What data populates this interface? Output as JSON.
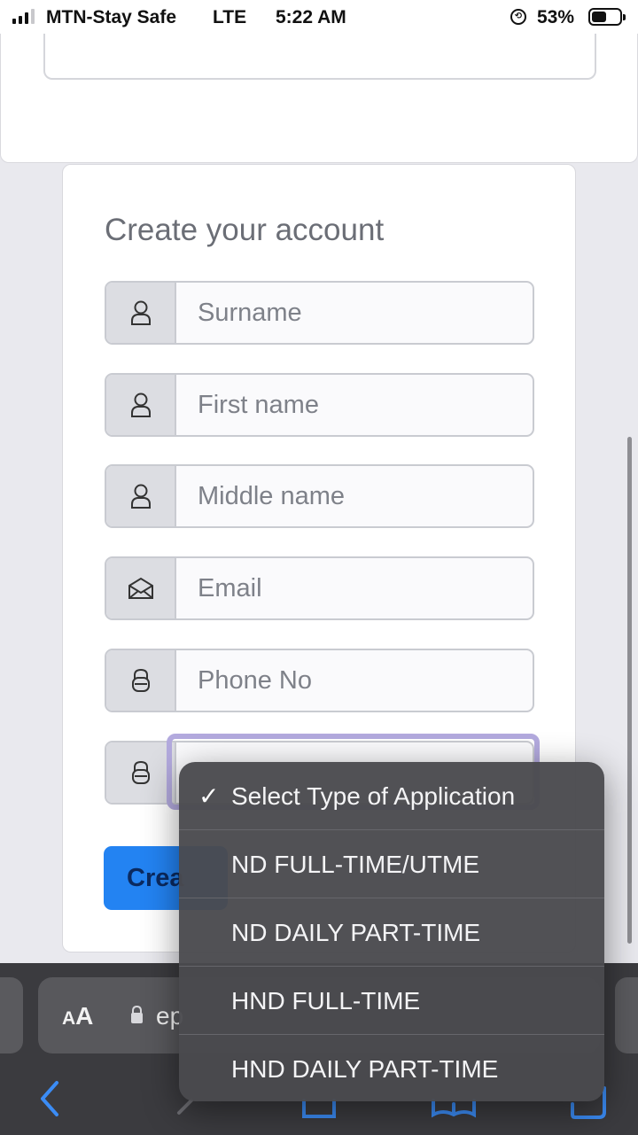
{
  "status_bar": {
    "carrier": "MTN-Stay Safe",
    "network": "LTE",
    "time": "5:22 AM",
    "battery": "53%",
    "battery_level": 0.53
  },
  "form": {
    "title": "Create your account",
    "fields": [
      {
        "placeholder": "Surname",
        "icon": "person-icon"
      },
      {
        "placeholder": "First name",
        "icon": "person-icon"
      },
      {
        "placeholder": "Middle name",
        "icon": "person-icon"
      },
      {
        "placeholder": "Email",
        "icon": "envelope-icon"
      },
      {
        "placeholder": "Phone No",
        "icon": "lock-icon"
      },
      {
        "placeholder": "",
        "icon": "lock-icon"
      }
    ],
    "submit_label": "Crea"
  },
  "picker": {
    "options": [
      {
        "label": "Select Type of Application",
        "selected": true
      },
      {
        "label": "ND FULL-TIME/UTME",
        "selected": false
      },
      {
        "label": "ND DAILY PART-TIME",
        "selected": false
      },
      {
        "label": "HND FULL-TIME",
        "selected": false
      },
      {
        "label": "HND DAILY PART-TIME",
        "selected": false
      }
    ],
    "check_mark": "✓"
  },
  "safari": {
    "aa_label_big": "A",
    "aa_label_small": "A",
    "url_text": "ep"
  },
  "colors": {
    "accent": "#2383f2",
    "focus_ring": "#b3aade",
    "safari_bg": "#3b3b3f",
    "picker_bg": "#4a4a4e"
  }
}
